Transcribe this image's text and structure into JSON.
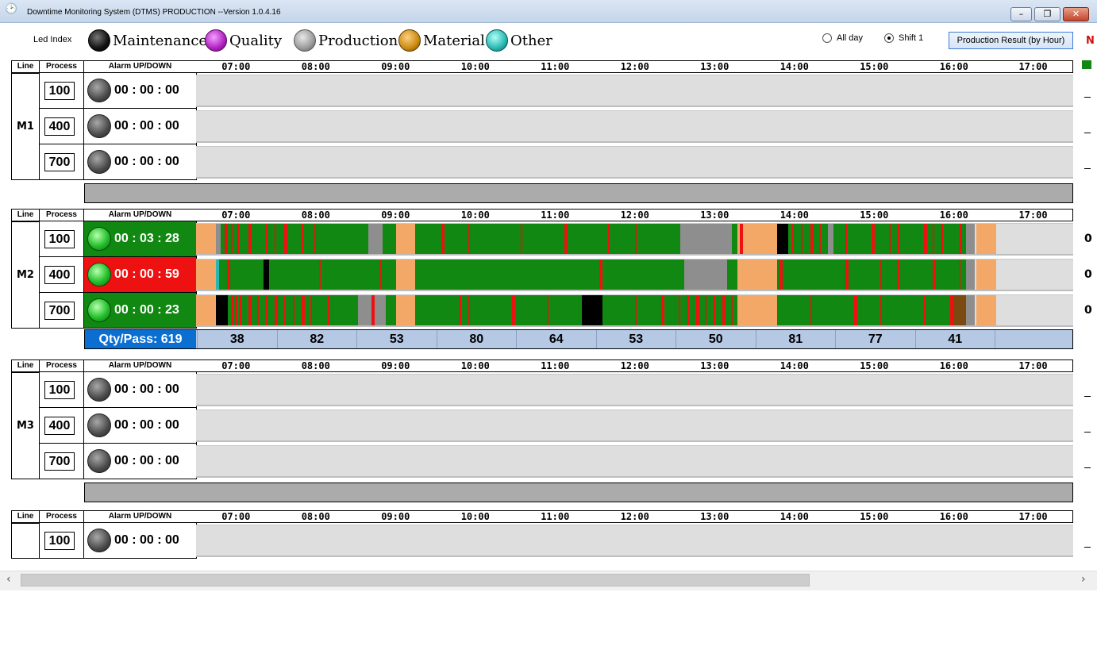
{
  "window": {
    "title": "Downtime Monitoring System (DTMS)  PRODUCTION --Version 1.0.4.16",
    "app_icon": "clock-icon"
  },
  "legend": {
    "led_index_label": "Led Index",
    "items": [
      {
        "label": "Maintenance",
        "color": "#111111"
      },
      {
        "label": "Quality",
        "color": "#b020c0"
      },
      {
        "label": "Production",
        "color": "#9a9a9a"
      },
      {
        "label": "Material",
        "color": "#c98a10"
      },
      {
        "label": "Other",
        "color": "#28b8b0"
      }
    ]
  },
  "range": {
    "all_day": "All day",
    "shift1": "Shift 1",
    "selected": "shift1"
  },
  "production_result_button": "Production Result (by Hour)",
  "headers": {
    "line": "Line",
    "process": "Process",
    "alarm": "Alarm  UP/DOWN"
  },
  "hours": [
    "07:00",
    "08:00",
    "09:00",
    "10:00",
    "11:00",
    "12:00",
    "13:00",
    "14:00",
    "15:00",
    "16:00",
    "17:00"
  ],
  "colors": {
    "run": "#118811",
    "stop": "#ee1111",
    "idle": "#8e8e8e",
    "break": "#f3a868",
    "maint": "#000000",
    "other": "#28b8b0",
    "empty": "#dedede",
    "brown": "#7a4a10"
  },
  "lines": [
    {
      "name": "M1",
      "rows": [
        {
          "process": "100",
          "time": "00 : 00 : 00",
          "led": "off"
        },
        {
          "process": "400",
          "time": "00 : 00 : 00",
          "led": "off"
        },
        {
          "process": "700",
          "time": "00 : 00 : 00",
          "led": "off"
        }
      ]
    },
    {
      "name": "M2",
      "qty_label": "Qty/Pass: 619",
      "qty": [
        "38",
        "82",
        "53",
        "80",
        "64",
        "53",
        "50",
        "81",
        "77",
        "41",
        ""
      ],
      "rows": [
        {
          "process": "100",
          "time": "00 : 03 : 28",
          "led": "green",
          "bg": "#118811",
          "right": "0"
        },
        {
          "process": "400",
          "time": "00 : 00 : 59",
          "led": "green",
          "bg": "#ee1111",
          "right": "0"
        },
        {
          "process": "700",
          "time": "00 : 00 : 23",
          "led": "green",
          "bg": "#118811",
          "right": "0"
        }
      ]
    },
    {
      "name": "M3",
      "rows": [
        {
          "process": "100",
          "time": "00 : 00 : 00",
          "led": "off"
        },
        {
          "process": "400",
          "time": "00 : 00 : 00",
          "led": "off"
        },
        {
          "process": "700",
          "time": "00 : 00 : 00",
          "led": "off"
        }
      ]
    },
    {
      "name": "",
      "rows": [
        {
          "process": "100",
          "time": "00 : 00 : 00",
          "led": "off"
        }
      ]
    }
  ]
}
